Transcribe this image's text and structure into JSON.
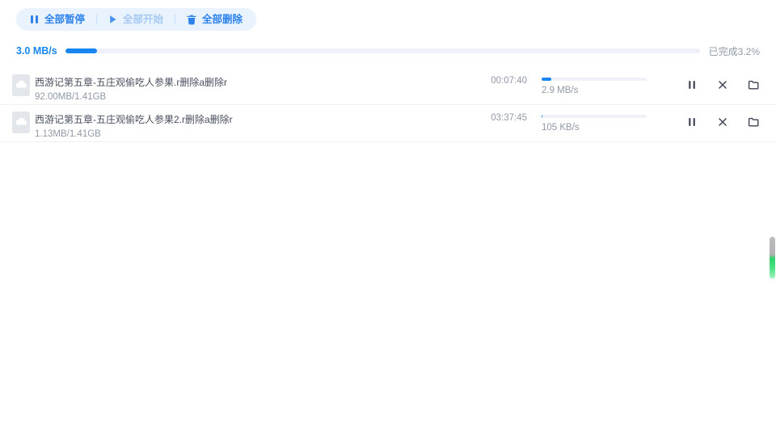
{
  "colors": {
    "accent_blue": "#1886f0",
    "toolbar_text_blue": "#2e82ec",
    "toolbar_disabled_blue": "#a6c9f3",
    "toolbar_background": "#e9f3fd",
    "progress_track": "#eef2f8",
    "filename_text": "#474e5d",
    "secondary_text": "#9099a8",
    "scrollbar_gray": "#b5b5b5",
    "scrollbar_green": "#2ed36e"
  },
  "toolbar": {
    "pause_all": "全部暂停",
    "start_all": "全部开始",
    "delete_all": "全部删除"
  },
  "summary": {
    "speed": "3.0 MB/s",
    "completed_label": "已完成3.2%",
    "completed_percent": 3.2,
    "bar_percent": 5
  },
  "downloads": [
    {
      "name": "西游记第五章-五庄观偷吃人参果.r删除a删除r",
      "size": "92.00MB/1.41GB",
      "time": "00:07:40",
      "speed": "2.9 MB/s",
      "bar_percent": 9
    },
    {
      "name": "西游记第五章-五庄观偷吃人参果2.r删除a删除r",
      "size": "1.13MB/1.41GB",
      "time": "03:37:45",
      "speed": "105 KB/s",
      "bar_percent": 1
    }
  ]
}
